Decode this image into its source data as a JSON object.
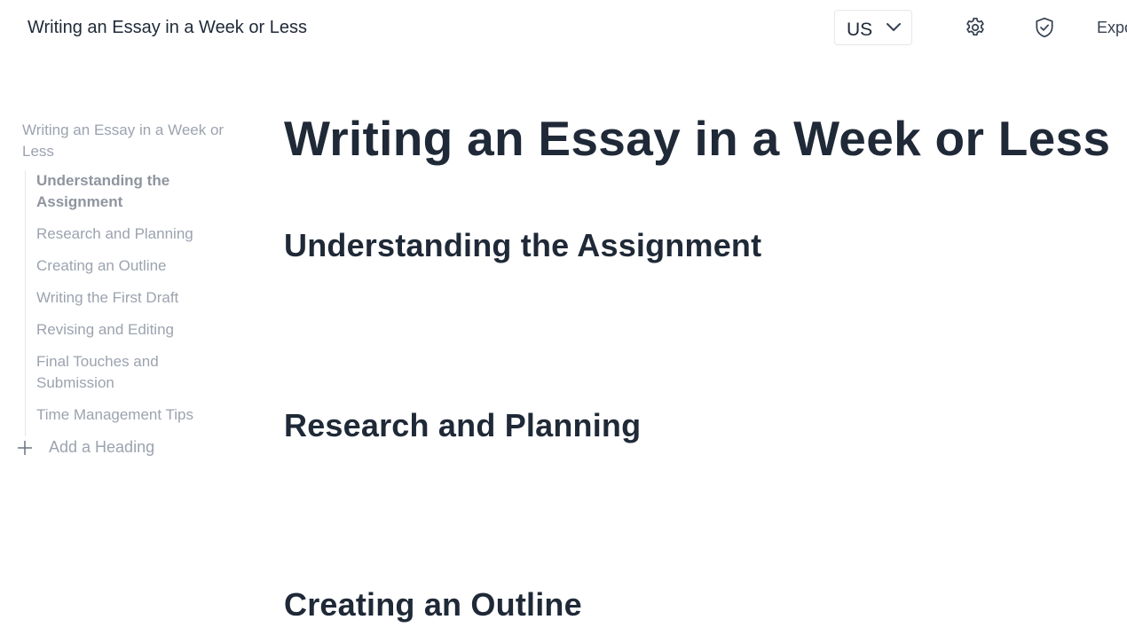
{
  "header": {
    "doc_title": "Writing an Essay in a Week or Less",
    "language": "US",
    "export_label": "Expo"
  },
  "sidebar": {
    "root_label": "Writing an Essay in a Week or Less",
    "items": [
      {
        "label": "Understanding the Assignment",
        "active": true
      },
      {
        "label": "Research and Planning"
      },
      {
        "label": "Creating an Outline"
      },
      {
        "label": "Writing the First Draft"
      },
      {
        "label": "Revising and Editing"
      },
      {
        "label": "Final Touches and Submission"
      },
      {
        "label": "Time Management Tips"
      }
    ],
    "add_heading_label": "Add a Heading"
  },
  "main": {
    "title": "Writing an Essay in a Week or Less",
    "sections": [
      {
        "heading": "Understanding the Assignment"
      },
      {
        "heading": "Research and Planning"
      },
      {
        "heading": "Creating an Outline"
      }
    ]
  },
  "colors": {
    "text_dark": "#1f2937",
    "text_muted": "#9ca3af",
    "border": "#e5e7eb"
  },
  "icons": {
    "language_dropdown": "chevron-down-icon",
    "settings": "gear-icon",
    "privacy": "shield-check-icon",
    "add": "plus-icon"
  }
}
